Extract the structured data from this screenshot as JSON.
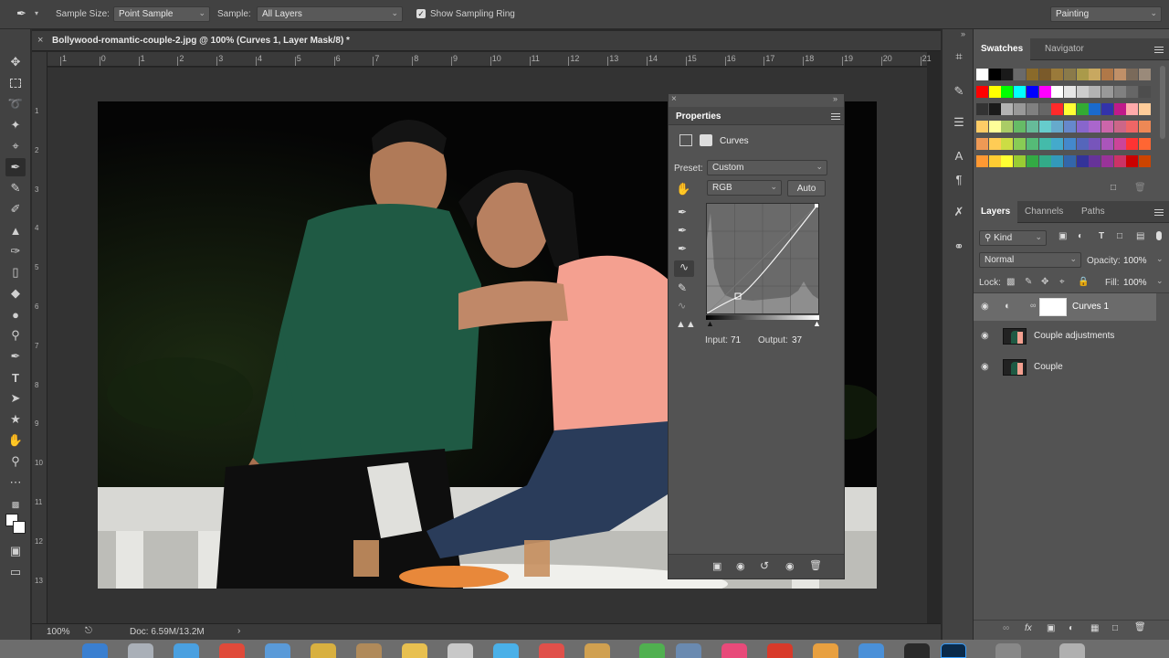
{
  "options_bar": {
    "tool_icon": "eyedropper-icon",
    "sample_size_label": "Sample Size:",
    "sample_size_value": "Point Sample",
    "sample_label": "Sample:",
    "sample_value": "All Layers",
    "show_ring_label": "Show Sampling Ring",
    "show_ring_checked": true,
    "workspace_value": "Painting"
  },
  "document": {
    "tab_title": "Bollywood-romantic-couple-2.jpg @ 100% (Curves 1, Layer Mask/8) *",
    "ruler_top": [
      "1",
      "0",
      "1",
      "2",
      "3",
      "4",
      "5",
      "6",
      "7",
      "8",
      "9",
      "10",
      "11",
      "12",
      "13",
      "14",
      "15",
      "16",
      "17",
      "18",
      "19",
      "20",
      "21"
    ],
    "ruler_left": [
      "1",
      "2",
      "3",
      "4",
      "5",
      "6",
      "7",
      "8",
      "9",
      "10",
      "11",
      "12",
      "13"
    ]
  },
  "status_bar": {
    "zoom": "100%",
    "doc_info": "Doc: 6.59M/13.2M"
  },
  "properties": {
    "title": "Properties",
    "adjustment_name": "Curves",
    "preset_label": "Preset:",
    "preset_value": "Custom",
    "channel_value": "RGB",
    "auto_label": "Auto",
    "input_label": "Input:",
    "input_value": "71",
    "output_label": "Output:",
    "output_value": "37"
  },
  "swatches_panel": {
    "tabs": [
      "Swatches",
      "Navigator"
    ],
    "active_tab": "Swatches",
    "colors": [
      "#ffffff",
      "#000000",
      "#1a1a1a",
      "#6a6a6a",
      "#8a6a2a",
      "#7a5a2a",
      "#9a7a3a",
      "#8a7a4a",
      "#aa9a4a",
      "#c8a860",
      "#b07848",
      "#c09068",
      "#7a6a5a",
      "#9a8a7a",
      "#ff0000",
      "#ffff00",
      "#00ff00",
      "#00ffff",
      "#0000ff",
      "#ff00ff",
      "#ffffff",
      "#e6e6e6",
      "#cccccc",
      "#b3b3b3",
      "#999999",
      "#808080",
      "#666666",
      "#4d4d4d",
      "#333333",
      "#1a1a1a",
      "#b3b3b3",
      "#999999",
      "#808080",
      "#666666",
      "#ff2a2a",
      "#ffff33",
      "#33aa33",
      "#1a6acc",
      "#3333aa",
      "#c01a8a",
      "#ffaaaa",
      "#ffcc99",
      "#ffcc66",
      "#ffff99",
      "#aacc66",
      "#66bb66",
      "#66bb99",
      "#66cccc",
      "#66aacc",
      "#6688cc",
      "#8866cc",
      "#aa66cc",
      "#cc66aa",
      "#cc6688",
      "#ee6666",
      "#ee8855",
      "#ee9955",
      "#ffcc55",
      "#ccdd44",
      "#88cc55",
      "#55bb77",
      "#44bbaa",
      "#44aacc",
      "#4488cc",
      "#5566bb",
      "#7755bb",
      "#aa55bb",
      "#cc4499",
      "#ff3333",
      "#ff6633",
      "#ff9933",
      "#ffcc33",
      "#ffff33",
      "#99cc33",
      "#33aa44",
      "#33aa88",
      "#3399bb",
      "#3366aa",
      "#333399",
      "#663399",
      "#993399",
      "#cc3366",
      "#cc0000",
      "#cc4400"
    ]
  },
  "layers_panel": {
    "tabs": [
      "Layers",
      "Channels",
      "Paths"
    ],
    "active_tab": "Layers",
    "filter_kind": "Kind",
    "blend_mode": "Normal",
    "opacity_label": "Opacity:",
    "opacity_value": "100%",
    "lock_label": "Lock:",
    "fill_label": "Fill:",
    "fill_value": "100%",
    "layers": [
      {
        "name": "Curves 1",
        "selected": true
      },
      {
        "name": "Couple adjustments",
        "selected": false
      },
      {
        "name": "Couple",
        "selected": false
      }
    ]
  },
  "colors": {
    "panel_bg": "#535353",
    "toolbar_bg": "#424242",
    "canvas_bg": "#333333",
    "selection": "#6b6b6b"
  }
}
